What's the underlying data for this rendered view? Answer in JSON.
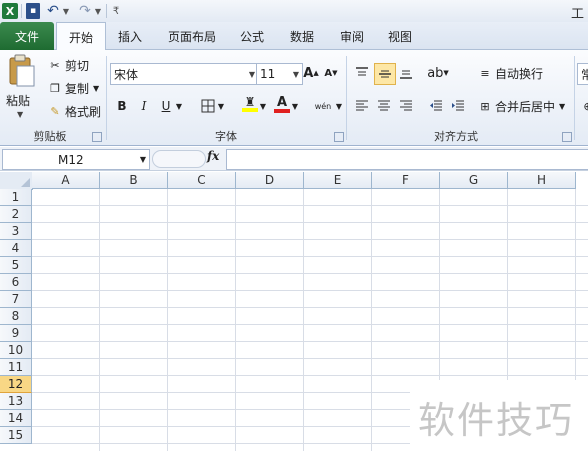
{
  "titlebar": {
    "title_fragment": "工"
  },
  "qat": {
    "app_icon": "X",
    "save_icon": "▪",
    "undo_icon": "↶",
    "redo_icon": "↷"
  },
  "tabs": [
    "文件",
    "开始",
    "插入",
    "页面布局",
    "公式",
    "数据",
    "审阅",
    "视图"
  ],
  "clipboard": {
    "paste": "粘贴",
    "cut": "剪切",
    "copy": "复制",
    "format_painter": "格式刷",
    "group": "剪贴板"
  },
  "font": {
    "name": "宋体",
    "size": "11",
    "grow": "A",
    "shrink": "A",
    "bold": "B",
    "italic": "I",
    "underline": "U",
    "phonetic": "wén",
    "group": "字体"
  },
  "alignment": {
    "wrap": "自动换行",
    "merge": "合并后居中",
    "group": "对齐方式"
  },
  "number": {
    "format_fragment": "常"
  },
  "formula_bar": {
    "name_box": "M12",
    "fx": "fx",
    "value": ""
  },
  "columns": [
    "A",
    "B",
    "C",
    "D",
    "E",
    "F",
    "G",
    "H"
  ],
  "rows": [
    "1",
    "2",
    "3",
    "4",
    "5",
    "6",
    "7",
    "8",
    "9",
    "10",
    "11",
    "12",
    "13",
    "14",
    "15"
  ],
  "selected_row": "12",
  "watermark": "软件技巧",
  "colors": {
    "file_tab": "#1e6b31",
    "selection": "#f8d785",
    "font_color_bar": "#e02020",
    "highlight_bar": "#ffff00"
  }
}
